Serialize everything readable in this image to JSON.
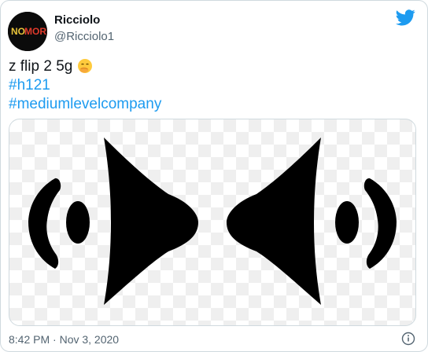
{
  "tweet": {
    "author": {
      "display_name": "Ricciolo",
      "handle": "@Ricciolo1",
      "avatar_text": "NO MORE"
    },
    "text_lines": [
      {
        "text": "z flip 2 5g",
        "emoji": "face-with-hand-over-mouth-icon"
      },
      {
        "text": "#h121"
      },
      {
        "text": "#mediumlevelcompany"
      }
    ],
    "media": {
      "description_icon": "speaker-pair-icon"
    },
    "timestamp": "8:42 PM · Nov 3, 2020",
    "colors": {
      "accent": "#1d9bf0",
      "text": "#0f1419",
      "secondary": "#536471",
      "border": "#cfd9de"
    }
  }
}
